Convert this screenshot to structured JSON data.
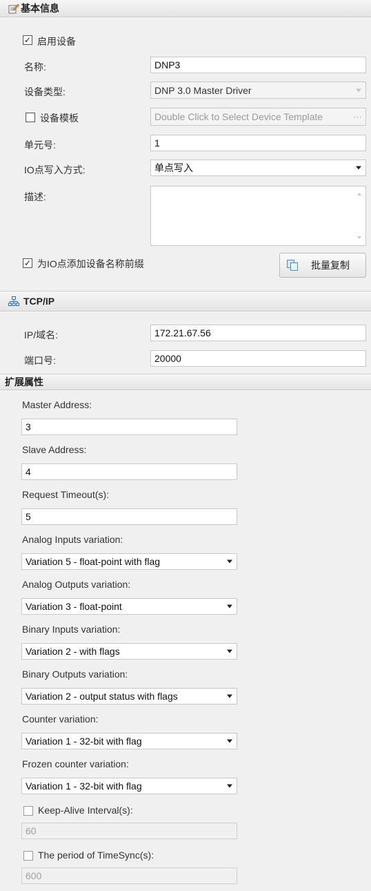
{
  "basic": {
    "header": "基本信息",
    "enable_label": "启用设备",
    "enable_checked": true,
    "name_label": "名称:",
    "name_value": "DNP3",
    "type_label": "设备类型:",
    "type_value": "DNP 3.0 Master Driver",
    "template_label": "设备模板",
    "template_checked": false,
    "template_placeholder": "Double Click to Select Device Template",
    "template_ellipsis": "···",
    "unit_label": "单元号:",
    "unit_value": "1",
    "io_write_label": "IO点写入方式:",
    "io_write_value": "单点写入",
    "desc_label": "描述:",
    "desc_value": "",
    "prefix_label": "为IO点添加设备名称前缀",
    "prefix_checked": true,
    "batch_copy_label": "批量复制"
  },
  "tcp": {
    "header": "TCP/IP",
    "ip_label": "IP/域名:",
    "ip_value": "172.21.67.56",
    "port_label": "端口号:",
    "port_value": "20000"
  },
  "ext": {
    "header": "扩展属性",
    "master_address_label": "Master Address:",
    "master_address_value": "3",
    "slave_address_label": "Slave Address:",
    "slave_address_value": "4",
    "request_timeout_label": "Request Timeout(s):",
    "request_timeout_value": "5",
    "analog_inputs_label": "Analog Inputs variation:",
    "analog_inputs_value": "Variation 5 - float-point with flag",
    "analog_outputs_label": "Analog Outputs variation:",
    "analog_outputs_value": "Variation 3 - float-point",
    "binary_inputs_label": "Binary Inputs variation:",
    "binary_inputs_value": "Variation 2 - with flags",
    "binary_outputs_label": "Binary Outputs variation:",
    "binary_outputs_value": "Variation 2 - output status with flags",
    "counter_label": "Counter variation:",
    "counter_value": "Variation 1 - 32-bit with flag",
    "frozen_counter_label": "Frozen counter variation:",
    "frozen_counter_value": "Variation 1 - 32-bit with flag",
    "keepalive_label": "Keep-Alive Interval(s):",
    "keepalive_checked": false,
    "keepalive_value": "60",
    "timesync_label": "The period of TimeSync(s):",
    "timesync_checked": false,
    "timesync_value": "600"
  },
  "colors": {
    "header_bg": "#e8e8e8",
    "panel_bg": "#f0f0f0",
    "field_border": "#c8c8c8",
    "network_icon": "#2a6fc9"
  },
  "icons": {
    "basic": "edit-document-icon",
    "tcp": "network-icon",
    "batch": "copy-icon"
  }
}
